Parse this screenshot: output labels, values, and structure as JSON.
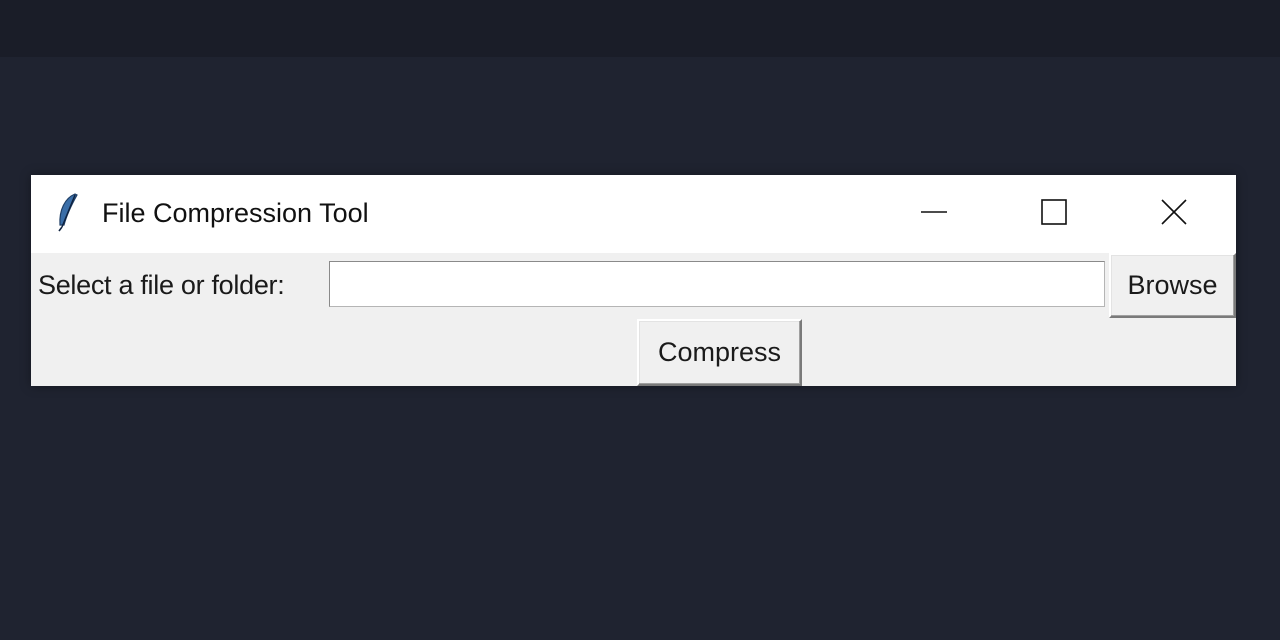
{
  "window": {
    "title": "File Compression Tool",
    "app_icon": "feather-icon",
    "controls": {
      "minimize_icon": "minimize-icon",
      "maximize_icon": "maximize-icon",
      "close_icon": "close-icon"
    }
  },
  "form": {
    "path_label": "Select a file or folder:",
    "path_value": "",
    "browse_label": "Browse",
    "compress_label": "Compress"
  },
  "colors": {
    "desktop_background": "#1f2330",
    "window_background": "#f0f0f0",
    "titlebar_background": "#ffffff"
  }
}
